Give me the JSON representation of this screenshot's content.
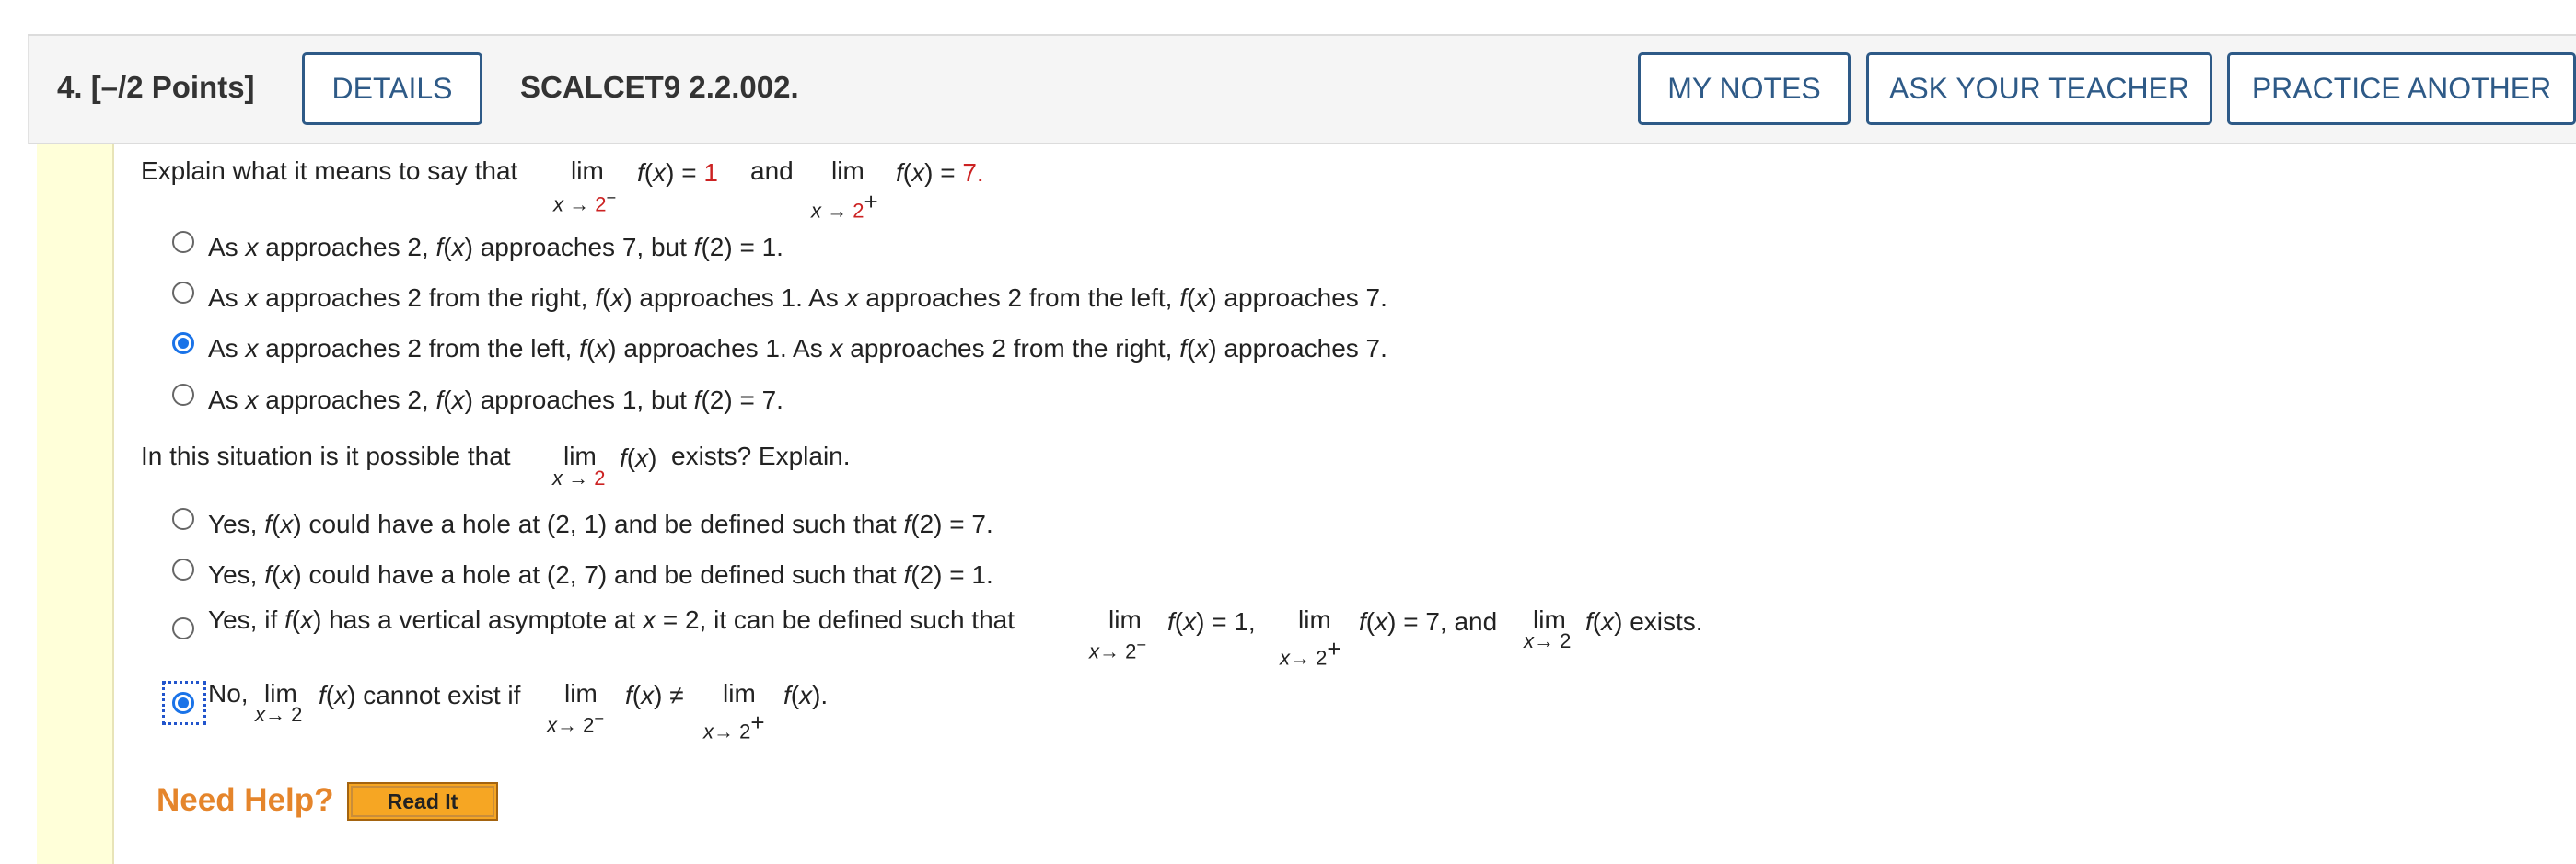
{
  "header": {
    "question_number": "4.  [–/2 Points]",
    "details_label": "DETAILS",
    "code": "SCALCET9 2.2.002.",
    "my_notes_label": "MY NOTES",
    "ask_teacher_label": "ASK YOUR TEACHER",
    "practice_label": "PRACTICE ANOTHER"
  },
  "q1": {
    "prompt_start": "Explain what it means to say that",
    "lim": "lim",
    "fx": "f(x)",
    "eq": "=",
    "val1": "1",
    "and": "and",
    "val2": "7.",
    "sub1": "x → 2",
    "sub1_sup": "−",
    "sub2": "x → 2",
    "sub2_sup": "+",
    "options": [
      "As x approaches 2, f(x) approaches 7, but f(2) = 1.",
      "As x approaches 2 from the right, f(x) approaches 1. As x approaches 2 from the left, f(x) approaches 7.",
      "As x approaches 2 from the left, f(x) approaches 1. As x approaches 2 from the right, f(x) approaches 7.",
      "As x approaches 2, f(x) approaches 1, but f(2) = 7."
    ],
    "selected": 2
  },
  "q2": {
    "prompt_start": "In this situation is it possible that",
    "prompt_end": "exists? Explain.",
    "options": [
      "Yes, f(x) could have a hole at (2, 1) and be defined such that f(2) = 7.",
      "Yes, f(x) could have a hole at (2, 7) and be defined such that f(2) = 1.",
      "Yes, if f(x) has a vertical asymptote at x = 2, it can be defined such that",
      "No,"
    ],
    "opt3_tail_a": "= 1,",
    "opt3_tail_b": "= 7, and",
    "opt3_tail_c": "exists.",
    "opt4_mid": "cannot exist if",
    "opt4_neq": "≠",
    "selected": 3
  },
  "help": {
    "need_help": "Need Help?",
    "read_it": "Read It"
  }
}
